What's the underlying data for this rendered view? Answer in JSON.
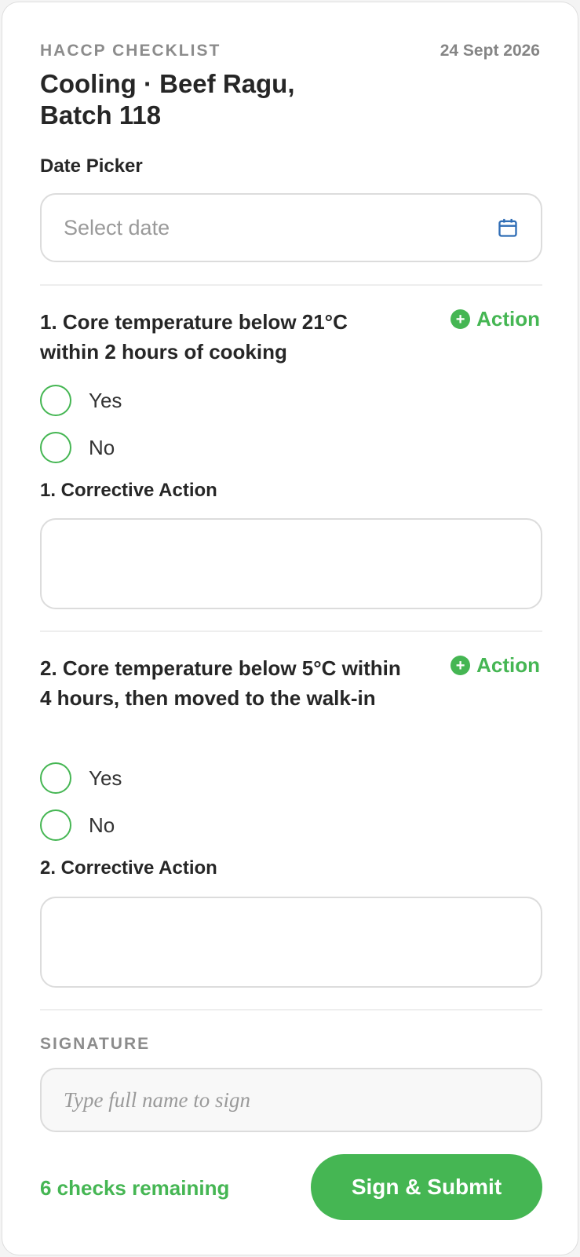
{
  "header": {
    "eyebrow": "HACCP CHECKLIST",
    "date": "24 Sept 2026",
    "title": "Cooling · Beef Ragu, Batch 118"
  },
  "date_picker": {
    "label": "Date Picker",
    "placeholder": "Select date",
    "icon": "calendar-icon"
  },
  "questions": [
    {
      "text": "1. Core temperature below 21°C within 2 hours of cooking",
      "action_label": "Action",
      "options": [
        "Yes",
        "No"
      ],
      "corrective_label": "1. Corrective Action",
      "corrective_value": ""
    },
    {
      "text": "2. Core temperature below 5°C within 4 hours, then moved to the walk-in",
      "action_label": "Action",
      "options": [
        "Yes",
        "No"
      ],
      "corrective_label": "2. Corrective Action",
      "corrective_value": ""
    }
  ],
  "signature": {
    "label": "SIGNATURE",
    "placeholder": "Type full name to sign",
    "value": ""
  },
  "footer": {
    "remaining": "6 checks remaining",
    "submit_label": "Sign & Submit"
  },
  "colors": {
    "accent": "#45b653",
    "calendar_icon": "#2f6db5",
    "border": "#dcdcdc"
  }
}
